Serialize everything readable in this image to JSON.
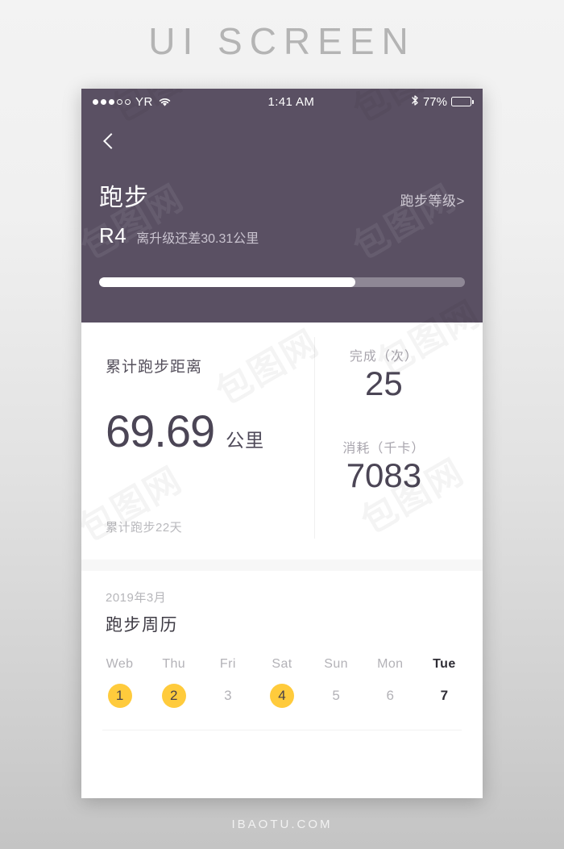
{
  "poster": {
    "title": "UI SCREEN",
    "footer": "IBAOTU.COM"
  },
  "colors": {
    "header_bg": "#5a5063",
    "accent_yellow": "#ffcb3c",
    "text_dark": "#4b4555",
    "text_muted": "#b3b2b7",
    "page_bg_top": "#f3f3f3",
    "page_bg_bottom": "#c4c4c4"
  },
  "statusbar": {
    "carrier": "YR",
    "signal_dots_filled": 3,
    "signal_dots_total": 5,
    "wifi_icon": "wifi-icon",
    "time": "1:41 AM",
    "bluetooth_icon": "bluetooth-icon",
    "battery_percent": "77%",
    "battery_fill_ratio": 0.62
  },
  "nav": {
    "back_icon": "chevron-left-icon"
  },
  "header": {
    "title": "跑步",
    "level_link": "跑步等级>",
    "rank_code": "R4",
    "rank_note": "离升级还差30.31公里",
    "progress_percent": 70
  },
  "stats": {
    "distance_label": "累计跑步距离",
    "distance_value": "69.69",
    "distance_unit": "公里",
    "days_note": "累计跑步22天",
    "metrics": [
      {
        "label": "完成（次）",
        "value": "25"
      },
      {
        "label": "消耗（千卡）",
        "value": "7083"
      }
    ]
  },
  "calendar": {
    "month": "2019年3月",
    "title": "跑步周历",
    "days": [
      {
        "dow": "Web",
        "date": "1",
        "active": true,
        "today": false
      },
      {
        "dow": "Thu",
        "date": "2",
        "active": true,
        "today": false
      },
      {
        "dow": "Fri",
        "date": "3",
        "active": false,
        "today": false
      },
      {
        "dow": "Sat",
        "date": "4",
        "active": true,
        "today": false
      },
      {
        "dow": "Sun",
        "date": "5",
        "active": false,
        "today": false
      },
      {
        "dow": "Mon",
        "date": "6",
        "active": false,
        "today": false
      },
      {
        "dow": "Tue",
        "date": "7",
        "active": false,
        "today": true
      }
    ]
  },
  "watermarks": {
    "text": "包图网"
  }
}
